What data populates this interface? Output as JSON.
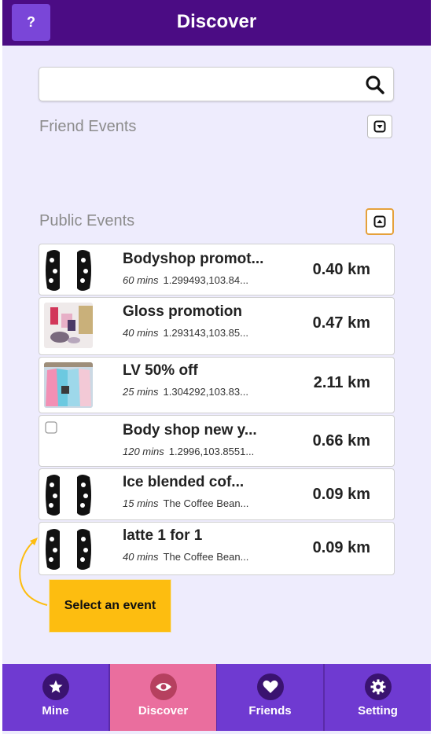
{
  "header": {
    "help_label": "?",
    "title": "Discover"
  },
  "search": {
    "value": "",
    "placeholder": ""
  },
  "sections": {
    "friend_events": {
      "label": "Friend Events"
    },
    "public_events": {
      "label": "Public Events"
    }
  },
  "events": [
    {
      "title": "Bodyshop promot...",
      "duration": "60 mins",
      "location": "1.299493,103.84...",
      "distance": "0.40 km",
      "thumb": "pattern"
    },
    {
      "title": "Gloss promotion",
      "duration": "40 mins",
      "location": "1.293143,103.85...",
      "distance": "0.47 km",
      "thumb": "cosmetics"
    },
    {
      "title": "LV 50% off",
      "duration": "25 mins",
      "location": "1.304292,103.83...",
      "distance": "2.11 km",
      "thumb": "clothes"
    },
    {
      "title": "Body shop new y...",
      "duration": "120 mins",
      "location": "1.2996,103.8551...",
      "distance": "0.66 km",
      "thumb": "broken-image"
    },
    {
      "title": "Ice blended cof...",
      "duration": "15 mins",
      "location": "The Coffee Bean...",
      "distance": "0.09 km",
      "thumb": "pattern"
    },
    {
      "title": "latte 1 for 1",
      "duration": "40 mins",
      "location": "The Coffee Bean...",
      "distance": "0.09 km",
      "thumb": "pattern"
    }
  ],
  "hint": {
    "text": "Select an event"
  },
  "nav": [
    {
      "label": "Mine",
      "icon": "star-icon",
      "active": false
    },
    {
      "label": "Discover",
      "icon": "eye-icon",
      "active": true
    },
    {
      "label": "Friends",
      "icon": "heart-icon",
      "active": false
    },
    {
      "label": "Setting",
      "icon": "gear-icon",
      "active": false
    }
  ],
  "colors": {
    "header_bg": "#4b0c84",
    "accent": "#7a46d8",
    "nav_bg": "#6f3ad1",
    "nav_active": "#ea6e9e",
    "hint_bg": "#fdbd10",
    "page_bg": "#eeecfd"
  }
}
